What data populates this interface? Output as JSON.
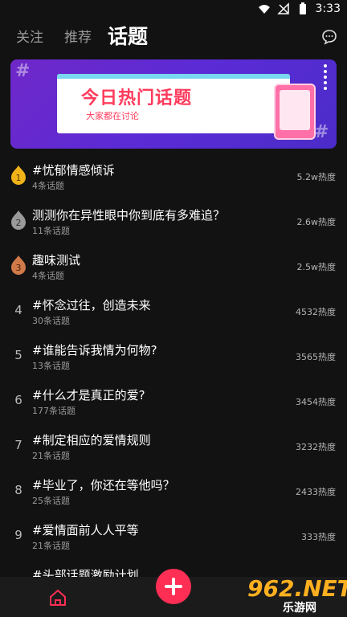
{
  "status_bar": {
    "time": "3:33"
  },
  "tabs": [
    {
      "label": "关注",
      "active": false
    },
    {
      "label": "推荐",
      "active": false
    },
    {
      "label": "话题",
      "active": true
    }
  ],
  "banner": {
    "title": "今日热门话题",
    "subtitle": "大家都在讨论"
  },
  "topics": [
    {
      "rank": "1",
      "title": "#忧郁情感倾诉",
      "count": "4条话题",
      "heat": "5.2w热度"
    },
    {
      "rank": "2",
      "title": "测测你在异性眼中你到底有多难追？",
      "count": "11条话题",
      "heat": "2.6w热度"
    },
    {
      "rank": "3",
      "title": "趣味测试",
      "count": "4条话题",
      "heat": "2.5w热度"
    },
    {
      "rank": "4",
      "title": "#怀念过往，创造未来",
      "count": "30条话题",
      "heat": "4532热度"
    },
    {
      "rank": "5",
      "title": "#谁能告诉我情为何物?",
      "count": "13条话题",
      "heat": "3565热度"
    },
    {
      "rank": "6",
      "title": "#什么才是真正的爱?",
      "count": "177条话题",
      "heat": "3454热度"
    },
    {
      "rank": "7",
      "title": "#制定相应的爱情规则",
      "count": "21条话题",
      "heat": "3232热度"
    },
    {
      "rank": "8",
      "title": "#毕业了，你还在等他吗？",
      "count": "25条话题",
      "heat": "2433热度"
    },
    {
      "rank": "9",
      "title": "#爱情面前人人平等",
      "count": "21条话题",
      "heat": "333热度"
    },
    {
      "rank": "10",
      "title": "#头部话题激励计划",
      "count": "",
      "heat": ""
    }
  ],
  "medal_colors": [
    "#f2b319",
    "#9a9a9a",
    "#d07a4a"
  ],
  "accent_color": "#ff2e55",
  "watermark": {
    "main": "962.NET",
    "sub": "乐游网"
  }
}
